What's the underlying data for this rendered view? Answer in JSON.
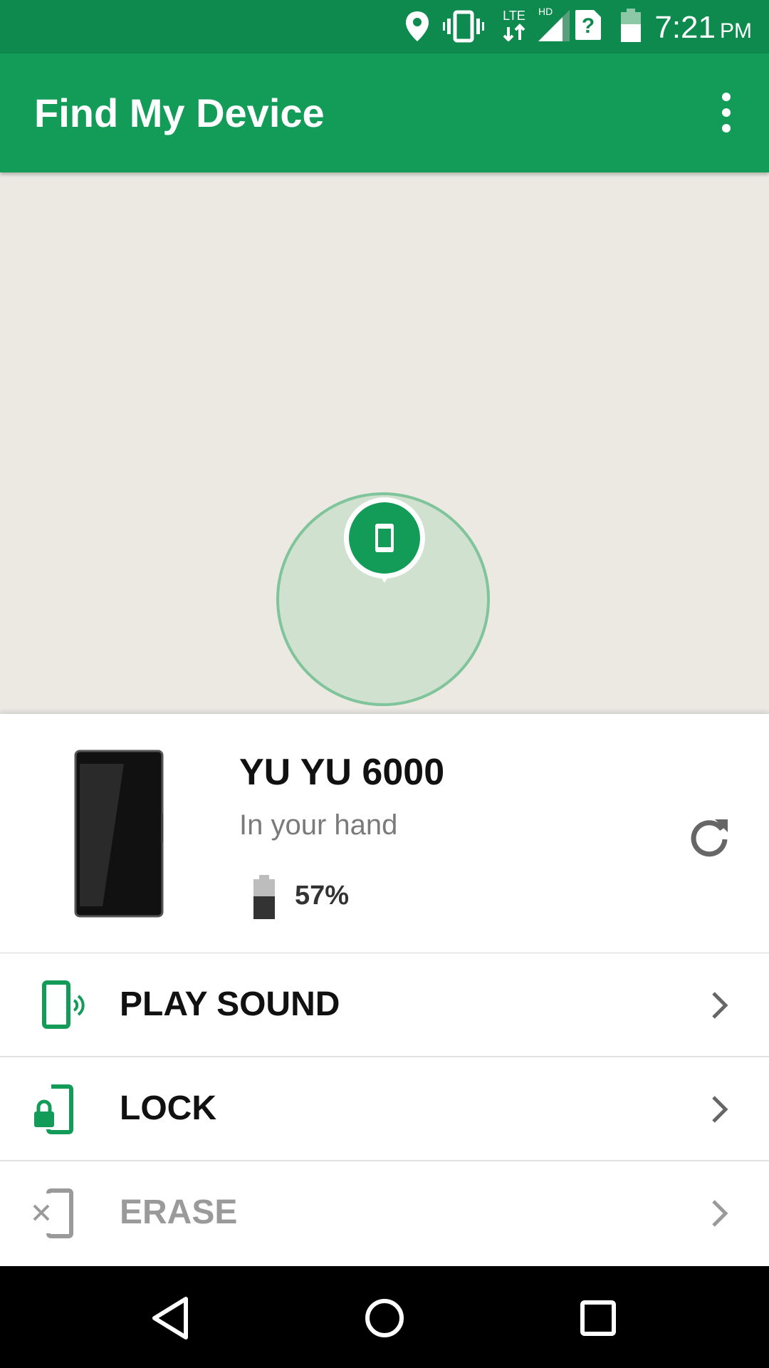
{
  "status_bar": {
    "time": "7:21",
    "ampm": "PM",
    "network_label": "LTE",
    "hd_label": "HD",
    "icons": [
      "location-icon",
      "vibrate-icon",
      "lte-data-icon",
      "signal-icon",
      "sim-unknown-icon",
      "battery-icon"
    ]
  },
  "app_bar": {
    "title": "Find My Device",
    "overflow_icon": "more-vert-icon"
  },
  "map": {
    "marker_icon": "phone-icon"
  },
  "device": {
    "name": "YU YU 6000",
    "status": "In your hand",
    "battery": "57%",
    "battery_fraction": 0.57,
    "refresh_icon": "refresh-icon"
  },
  "actions": [
    {
      "label": "PLAY SOUND",
      "icon": "play-sound-icon",
      "enabled": true
    },
    {
      "label": "LOCK",
      "icon": "lock-icon",
      "enabled": true
    },
    {
      "label": "ERASE",
      "icon": "erase-icon",
      "enabled": false
    }
  ],
  "nav_bar": {
    "buttons": [
      "back-icon",
      "home-icon",
      "recents-icon"
    ]
  },
  "colors": {
    "status_bar": "#0f8a4f",
    "app_bar": "#139c58",
    "accent": "#139c58",
    "map_bg": "#ebe9e2"
  }
}
